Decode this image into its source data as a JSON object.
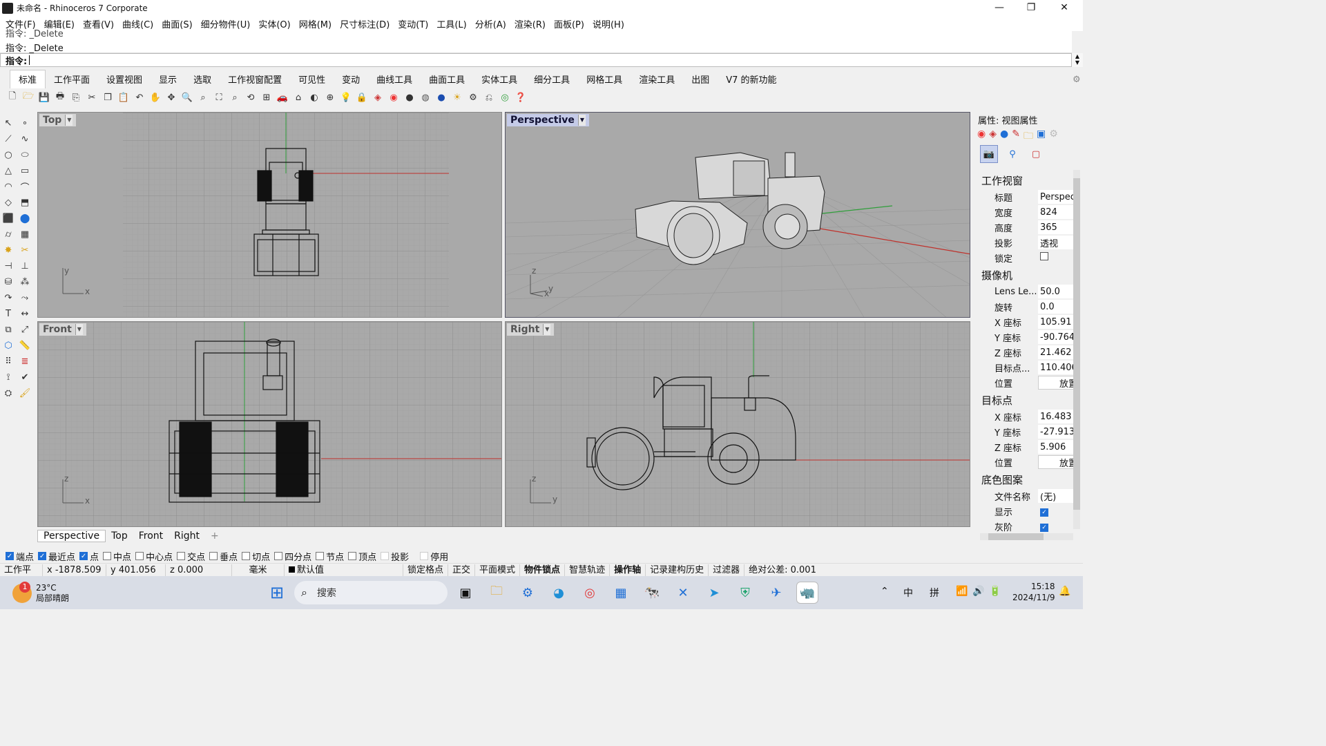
{
  "window": {
    "title": "未命名 - Rhinoceros 7 Corporate",
    "controls": [
      "—",
      "❐",
      "✕"
    ]
  },
  "menu": [
    "文件(F)",
    "编辑(E)",
    "查看(V)",
    "曲线(C)",
    "曲面(S)",
    "细分物件(U)",
    "实体(O)",
    "网格(M)",
    "尺寸标注(D)",
    "变动(T)",
    "工具(L)",
    "分析(A)",
    "渲染(R)",
    "面板(P)",
    "说明(H)"
  ],
  "command": {
    "history_1": "指令: _Delete",
    "history_2": "指令: _Delete",
    "prompt": "指令:",
    "value": ""
  },
  "tabs": [
    "标准",
    "工作平面",
    "设置视图",
    "显示",
    "选取",
    "工作视窗配置",
    "可见性",
    "变动",
    "曲线工具",
    "曲面工具",
    "实体工具",
    "细分工具",
    "网格工具",
    "渲染工具",
    "出图",
    "V7 的新功能"
  ],
  "active_tab": "标准",
  "toolbar_icons": [
    "new-icon",
    "open-icon",
    "save-icon",
    "print-icon",
    "import-icon",
    "cut-icon",
    "copy-icon",
    "paste-icon",
    "undo-icon",
    "pan-icon",
    "move-icon",
    "zoom-icon",
    "zoom-window-icon",
    "zoom-extents-icon",
    "zoom-selected-icon",
    "rotate-view-icon",
    "four-viewports-icon",
    "car-icon",
    "walkabout-icon",
    "hide-icon",
    "show-icon",
    "light-icon",
    "lock-icon",
    "layer-icon",
    "color-wheel-icon",
    "render-sphere-icon",
    "material-icon",
    "render-icon",
    "sun-icon",
    "options-icon",
    "snapshot-icon",
    "osnap-icon",
    "help-icon"
  ],
  "viewports": {
    "top": {
      "label": "Top",
      "axis_y": "y",
      "axis_x": "x"
    },
    "perspective": {
      "label": "Perspective",
      "axis_z": "z",
      "axis_y": "y",
      "axis_x": "x"
    },
    "front": {
      "label": "Front",
      "axis_z": "z",
      "axis_x": "x"
    },
    "right": {
      "label": "Right",
      "axis_z": "z",
      "axis_y": "y"
    }
  },
  "viewport_tabs": [
    "Perspective",
    "Top",
    "Front",
    "Right"
  ],
  "viewport_tab_add": "+",
  "osnap": [
    {
      "label": "端点",
      "checked": true
    },
    {
      "label": "最近点",
      "checked": true
    },
    {
      "label": "点",
      "checked": true
    },
    {
      "label": "中点",
      "checked": false
    },
    {
      "label": "中心点",
      "checked": false
    },
    {
      "label": "交点",
      "checked": false
    },
    {
      "label": "垂点",
      "checked": false
    },
    {
      "label": "切点",
      "checked": false
    },
    {
      "label": "四分点",
      "checked": false
    },
    {
      "label": "节点",
      "checked": false
    },
    {
      "label": "顶点",
      "checked": false
    },
    {
      "label": "投影",
      "checked": false
    },
    {
      "label": "停用",
      "checked": false
    }
  ],
  "status": {
    "cplane": "工作平面",
    "x": "x -1878.509",
    "y": "y 401.056",
    "z": "z 0.000",
    "units": "毫米",
    "layer": "默认值",
    "grid_snap": "锁定格点",
    "ortho": "正交",
    "planar": "平面模式",
    "osnap": "物件锁点",
    "smarttrack": "智慧轨迹",
    "gumball": "操作轴",
    "history": "记录建构历史",
    "filter": "过滤器",
    "tolerance": "绝对公差: 0.001"
  },
  "properties": {
    "title": "属性: 视图属性",
    "section_viewport": "工作视窗",
    "title_label": "标题",
    "title_value": "Perspec",
    "width_label": "宽度",
    "width_value": "824",
    "height_label": "高度",
    "height_value": "365",
    "projection_label": "投影",
    "projection_value": "透视",
    "lock_label": "锁定",
    "section_camera": "摄像机",
    "lens_label": "Lens Le...",
    "lens_value": "50.0",
    "rotation_label": "旋转",
    "rotation_value": "0.0",
    "cam_x_label": "X 座标",
    "cam_x_value": "105.91",
    "cam_y_label": "Y 座标",
    "cam_y_value": "-90.764",
    "cam_z_label": "Z 座标",
    "cam_z_value": "21.462",
    "target_dist_label": "目标点...",
    "target_dist_value": "110.406",
    "position_label": "位置",
    "place_button": "放置",
    "section_target": "目标点",
    "tgt_x_label": "X 座标",
    "tgt_x_value": "16.483",
    "tgt_y_label": "Y 座标",
    "tgt_y_value": "-27.913",
    "tgt_z_label": "Z 座标",
    "tgt_z_value": "5.906",
    "tgt_position_label": "位置",
    "tgt_place_button": "放置",
    "section_wallpaper": "底色图案",
    "filename_label": "文件名称",
    "filename_value": "(无)",
    "show_label": "显示",
    "gray_label": "灰阶"
  },
  "taskbar": {
    "weather_temp": "23°C",
    "weather_desc": "局部晴朗",
    "search_placeholder": "搜索",
    "ime_1": "中",
    "ime_2": "拼",
    "time": "15:18",
    "date": "2024/11/9",
    "badge": "1"
  },
  "colors": {
    "x_axis": "#c0302a",
    "y_axis": "#2f9e3a",
    "viewport_bg": "#a9a9a9",
    "grid": "#9a9a9a",
    "accent": "#1f6fd6"
  }
}
